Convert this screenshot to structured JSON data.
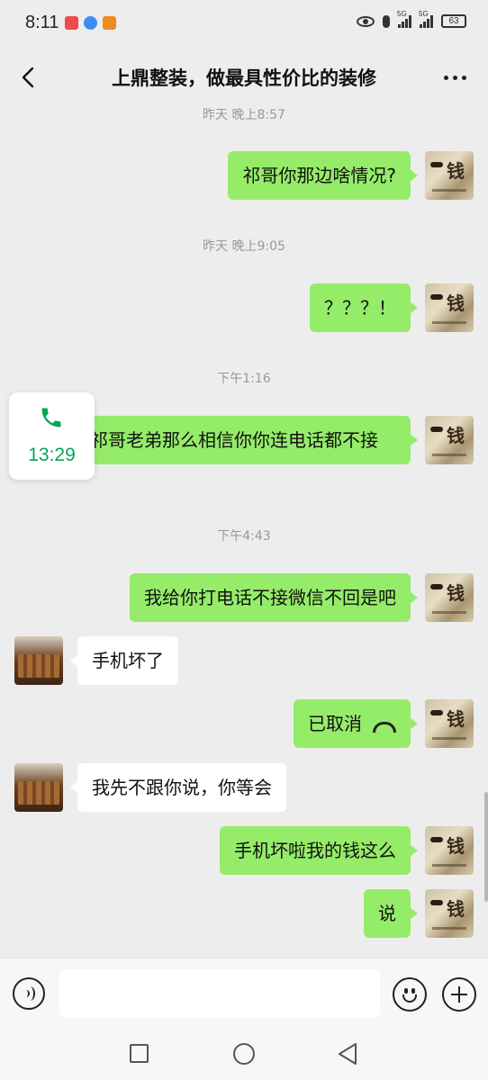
{
  "status_bar": {
    "time": "8:11",
    "battery": "63",
    "signal1": "5G",
    "signal2": "5G"
  },
  "header": {
    "title": "上鼎整装，做最具性价比的装修",
    "back_icon": "chevron-left-icon",
    "more_icon": "more-dots-icon"
  },
  "call_widget": {
    "duration": "13:29",
    "icon": "phone-icon",
    "color": "#07a35a"
  },
  "messages": [
    {
      "type": "timestamp",
      "text": "昨天 晚上8:57"
    },
    {
      "type": "sent",
      "text": "祁哥你那边啥情况?"
    },
    {
      "type": "timestamp",
      "text": "昨天 晚上9:05"
    },
    {
      "type": "sent",
      "text": "？？？！"
    },
    {
      "type": "timestamp",
      "text": "下午1:16"
    },
    {
      "type": "sent",
      "text": "祁哥老弟那么相信你你连电话都不接"
    },
    {
      "type": "timestamp",
      "text": "下午4:43"
    },
    {
      "type": "sent",
      "text": "我给你打电话不接微信不回是吧"
    },
    {
      "type": "received",
      "text": "手机坏了"
    },
    {
      "type": "sent_call",
      "text": "已取消",
      "icon": "hang-up-icon"
    },
    {
      "type": "received",
      "text": "我先不跟你说，你等会"
    },
    {
      "type": "sent",
      "text": "手机坏啦我的钱这么"
    },
    {
      "type": "sent",
      "text": "说"
    }
  ],
  "avatars": {
    "me_glyph": "钱"
  },
  "input_bar": {
    "voice_icon": "voice-icon",
    "emoji_icon": "emoji-icon",
    "plus_icon": "plus-icon",
    "value": ""
  },
  "colors": {
    "sent_bubble": "#95ec69",
    "received_bubble": "#ffffff",
    "background": "#ededed"
  }
}
